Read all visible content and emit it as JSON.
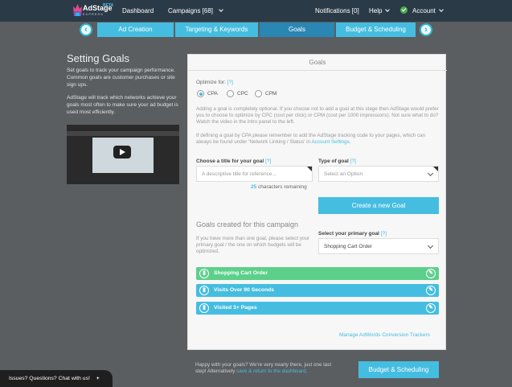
{
  "topbar": {
    "logo_name": "AdStage",
    "logo_beta": "BETA",
    "logo_express": "EXPRESS",
    "dashboard": "Dashboard",
    "campaigns": "Campaigns [68]",
    "notifications": "Notifications [0]",
    "help": "Help",
    "account": "Account"
  },
  "wizard": {
    "prev": "‹",
    "next": "›",
    "steps": [
      "Ad Creation",
      "Targeting & Keywords",
      "Goals",
      "Budget & Scheduling"
    ]
  },
  "left": {
    "title": "Setting Goals",
    "p1": "Set goals to track your campaign performance. Common goals are customer purchases or site sign ups.",
    "p2": "AdStage will track which networks achieve your goals most often to make sure your ad budget is used most efficiently."
  },
  "panel": {
    "title": "Goals",
    "optimize_label": "Optimize for:",
    "help": "[?]",
    "radios": [
      "CPA",
      "CPC",
      "CPM"
    ],
    "para1": "Adding a goal is completely optional. If you choose not to add a goal at this stage then AdStage would prefer you to choose to optimize by CPC (cost per click) or CPM (cost per 1000 impressions). Not sure what to do? Watch the video in the intro panel to the left.",
    "para2_text": "If defining a goal by CPA please remember to add the AdStage tracking code to your pages, which can always be found under 'Network Linking / Status' in",
    "para2_link": "Account Settings.",
    "title_label": "Choose a title for your goal",
    "title_placeholder": "A descriptive title for reference...",
    "chars_count": "25",
    "chars_text": "characters remaining",
    "type_label": "Type of goal",
    "type_value": "Select an Option",
    "create_button": "Create a new Goal",
    "goals_heading": "Goals created for this campaign",
    "multi_text": "If you have more than one goal, please select your primary goal / the one on which budgets will be optimized.",
    "primary_label": "Select your primary goal",
    "primary_value": "Shopping Cart Order",
    "goals": [
      "Shopping Cart Order",
      "Visits Over 90 Seconds",
      "Visited 3+ Pages"
    ],
    "manage_link": "Manage AdWords Conversion Trackers"
  },
  "footer": {
    "text": "Happy with your goals? We're very nearly there, just one last step! Alternatively",
    "link": "save & return to the dashboard.",
    "button": "Budget & Scheduling"
  },
  "chat": {
    "label": "Issues? Questions? Chat with us!",
    "plus": "+"
  },
  "colors": {
    "accent": "#45bde0",
    "goal_green": "#5cd08a",
    "topbar": "#2b3a47"
  }
}
